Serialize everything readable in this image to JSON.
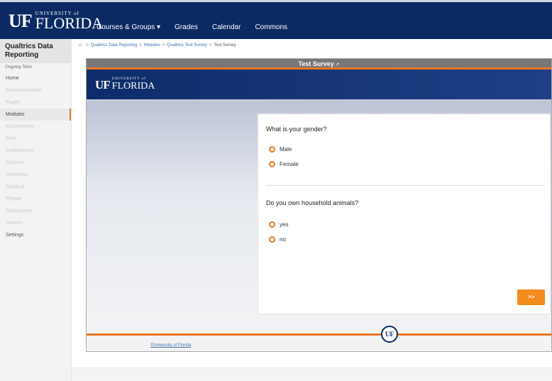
{
  "header": {
    "logo_uf": "UF",
    "logo_university": "UNIVERSITY of",
    "logo_florida": "FLORIDA",
    "nav": [
      "Courses & Groups ▾",
      "Grades",
      "Calendar",
      "Commons"
    ]
  },
  "sidebar": {
    "course_title": "Qualtrics Data Reporting",
    "term": "Ongoing Term",
    "items": [
      {
        "label": "Home",
        "state": "enabled"
      },
      {
        "label": "Announcements",
        "state": "disabled"
      },
      {
        "label": "Pages",
        "state": "disabled"
      },
      {
        "label": "Modules",
        "state": "active"
      },
      {
        "label": "Assignments",
        "state": "disabled"
      },
      {
        "label": "Files",
        "state": "disabled"
      },
      {
        "label": "Conferences",
        "state": "disabled"
      },
      {
        "label": "Quizzes",
        "state": "disabled"
      },
      {
        "label": "Outcomes",
        "state": "disabled"
      },
      {
        "label": "Syllabus",
        "state": "disabled"
      },
      {
        "label": "People",
        "state": "disabled"
      },
      {
        "label": "Discussions",
        "state": "disabled"
      },
      {
        "label": "Grades",
        "state": "disabled"
      },
      {
        "label": "Settings",
        "state": "enabled"
      }
    ]
  },
  "breadcrumb": {
    "items": [
      "Qualtrics Data Reporting",
      "Modules",
      "Qualtrics Test Survey"
    ],
    "current": "Test Survey"
  },
  "survey": {
    "title": "Test Survey",
    "banner_uf": "UF",
    "banner_university": "UNIVERSITY of",
    "banner_florida": "FLORIDA",
    "questions": [
      {
        "text": "What is your gender?",
        "options": [
          "Male",
          "Female"
        ]
      },
      {
        "text": "Do you own household animals?",
        "options": [
          "yes",
          "no"
        ]
      }
    ],
    "next_label": ">>",
    "seal": "UF",
    "copyright": "©University of Florida"
  },
  "colors": {
    "nav_bg": "#0b2a63",
    "accent_orange": "#e87722",
    "button_orange": "#f28a1e",
    "link_blue": "#3a6fb0"
  }
}
